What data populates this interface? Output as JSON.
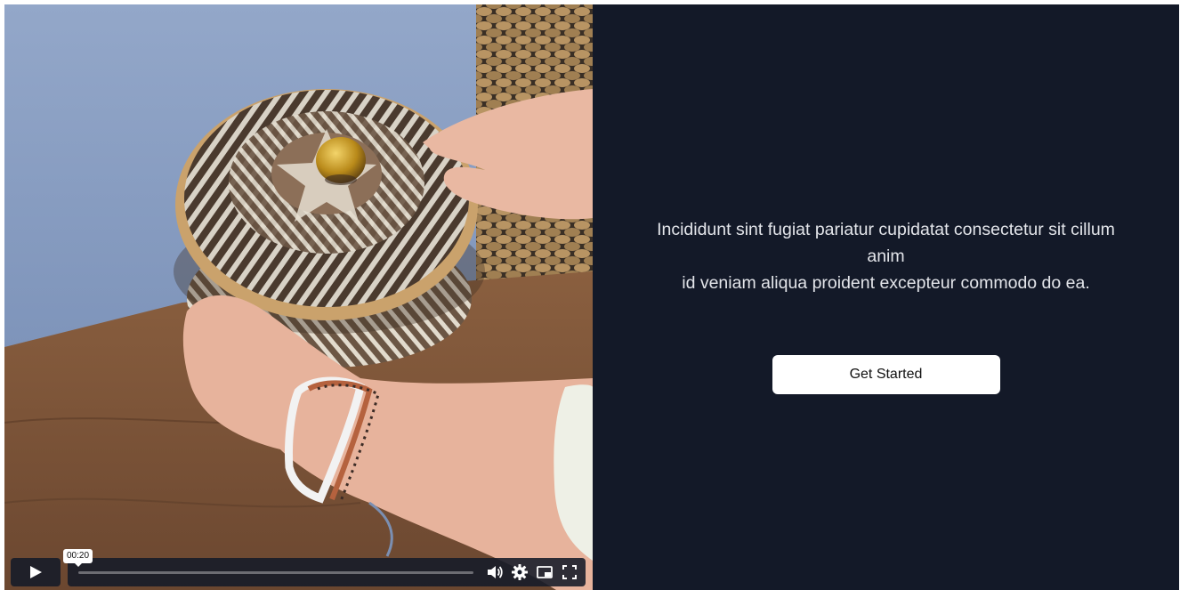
{
  "video": {
    "current_time": "00:20",
    "progress": 0,
    "icons": {
      "play": "play-icon",
      "volume": "volume-icon",
      "settings": "gear-icon",
      "pip": "picture-in-picture-icon",
      "fullscreen": "fullscreen-icon"
    }
  },
  "content": {
    "line1": "Incididunt sint fugiat pariatur cupidatat consectetur sit cillum anim",
    "line2": "id veniam aliqua proident excepteur commodo do ea.",
    "cta_label": "Get Started"
  },
  "colors": {
    "content_background": "#131928",
    "button_background": "#ffffff",
    "controls_background": "#141a28"
  }
}
